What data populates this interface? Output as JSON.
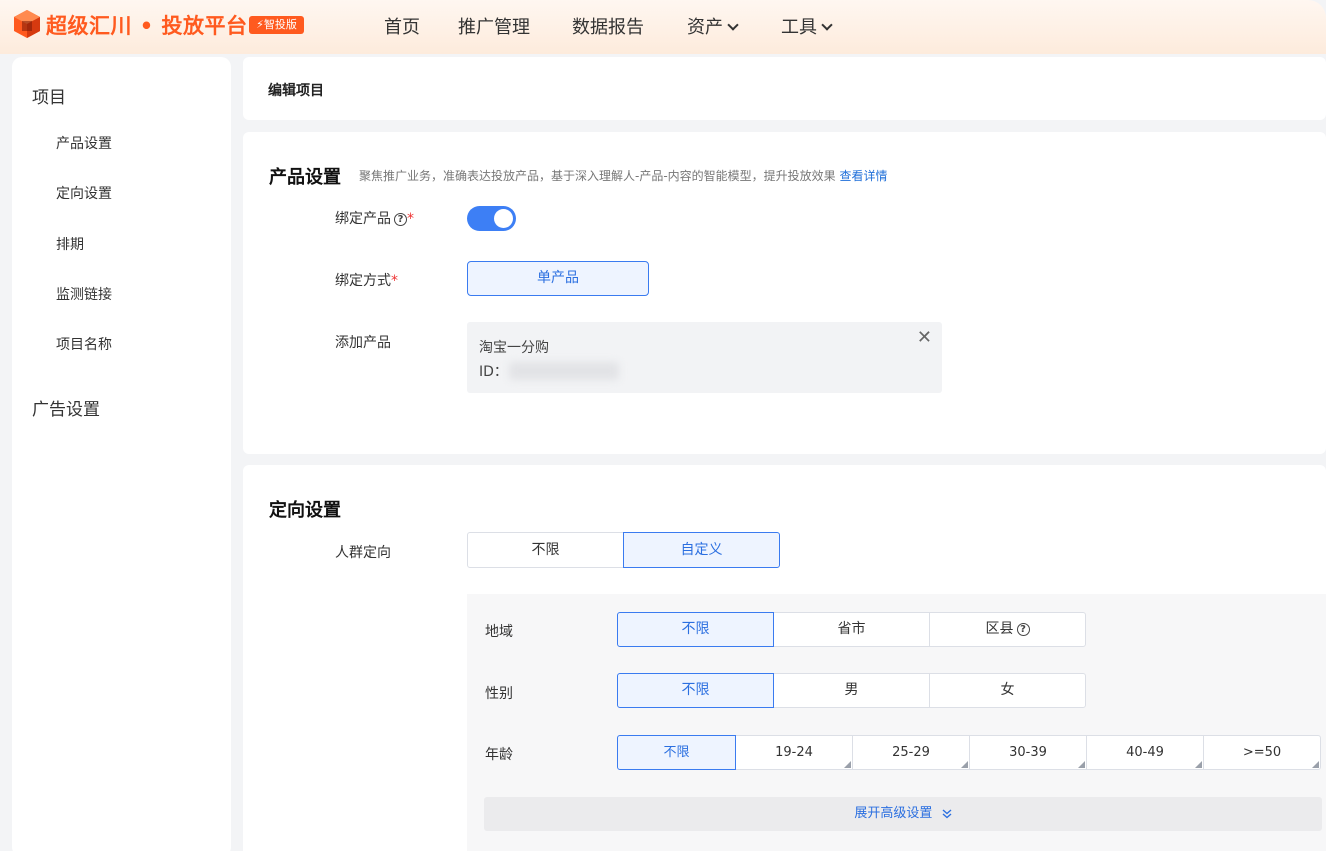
{
  "header": {
    "brand": "超级汇川 • 投放平台",
    "badge": "⚡智投版",
    "nav": [
      "首页",
      "推广管理",
      "数据报告",
      "资产",
      "工具"
    ]
  },
  "sidebar": {
    "group1": "项目",
    "items": [
      "产品设置",
      "定向设置",
      "排期",
      "监测链接",
      "项目名称"
    ],
    "group2": "广告设置"
  },
  "page": {
    "title": "编辑项目"
  },
  "product_settings": {
    "title": "产品设置",
    "desc": "聚焦推广业务，准确表达投放产品，基于深入理解人-产品-内容的智能模型，提升投放效果",
    "desc_link": "查看详情",
    "bind_product_label": "绑定产品",
    "bind_product_on": true,
    "bind_mode_label": "绑定方式",
    "bind_mode_value": "单产品",
    "add_product_label": "添加产品",
    "product_name": "淘宝一分购",
    "product_id_label": "ID："
  },
  "targeting": {
    "title": "定向设置",
    "audience_label": "人群定向",
    "audience_options": [
      "不限",
      "自定义"
    ],
    "audience_selected": "自定义",
    "region_label": "地域",
    "region_options": [
      "不限",
      "省市",
      "区县"
    ],
    "gender_label": "性别",
    "gender_options": [
      "不限",
      "男",
      "女"
    ],
    "age_label": "年龄",
    "age_options": [
      "不限",
      "19-24",
      "25-29",
      "30-39",
      "40-49",
      ">=50"
    ],
    "expand_label": "展开高级设置"
  },
  "colors": {
    "brand": "#ff5a1f",
    "accent": "#3a7bf0"
  }
}
